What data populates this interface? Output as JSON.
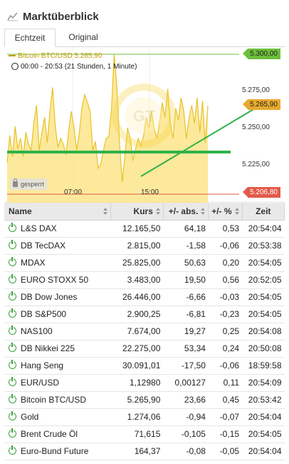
{
  "header": {
    "title": "Marktüberblick",
    "icon": "chart-line-icon"
  },
  "tabs": [
    {
      "label": "Echtzeit",
      "active": true
    },
    {
      "label": "Original",
      "active": false
    }
  ],
  "chart": {
    "series_label": "Bitcoin BTC/USD  5.265,90",
    "time_label": "00:00 - 20:53   (21 Stunden, 1 Minute)",
    "price_tags": {
      "high": "5.300,00",
      "current": "5.265,90",
      "low": "5.206,80"
    },
    "y_axis": [
      "5.275,00",
      "5.250,00",
      "5.225,00"
    ],
    "x_axis": [
      "07:00",
      "15:00"
    ],
    "locked_label": "gesperrt",
    "colors": {
      "fill": "#fbe27a",
      "line": "#e8c22a",
      "support": "#2fb34a",
      "high": "#6cbf3c",
      "current": "#e6a92e",
      "low": "#e35a4a"
    }
  },
  "chart_data": {
    "type": "area",
    "title": "Bitcoin BTC/USD",
    "x_range": [
      "00:00",
      "20:53"
    ],
    "ylim": [
      5206.8,
      5300.0
    ],
    "y_ticks": [
      5275.0,
      5250.0,
      5225.0
    ],
    "x_ticks": [
      "07:00",
      "15:00"
    ],
    "series": [
      {
        "name": "Bitcoin BTC/USD",
        "values": [
          5228,
          5246,
          5232,
          5252,
          5237,
          5244,
          5232,
          5248,
          5240,
          5236,
          5255,
          5266,
          5236,
          5248,
          5258,
          5241,
          5262,
          5278,
          5252,
          5238,
          5244,
          5240,
          5233,
          5249,
          5262,
          5251,
          5236,
          5248,
          5265,
          5273,
          5268,
          5262,
          5236,
          5242,
          5224,
          5227,
          5236,
          5244,
          5245,
          5263,
          5300,
          5278,
          5241,
          5215,
          5232,
          5251,
          5244,
          5229,
          5237,
          5244,
          5239,
          5246,
          5258,
          5251,
          5262,
          5250,
          5244,
          5255,
          5268,
          5258,
          5277,
          5254,
          5244,
          5264,
          5256,
          5271,
          5262,
          5244,
          5258,
          5266,
          5254,
          5271,
          5248,
          5269,
          5241,
          5265.9
        ]
      }
    ],
    "levels": {
      "high": 5300.0,
      "current": 5265.9,
      "low": 5206.8
    }
  },
  "table": {
    "headers": {
      "name": "Name",
      "kurs": "Kurs",
      "abs": "+/- abs.",
      "pct": "+/- %",
      "zeit": "Zeit"
    },
    "rows": [
      {
        "name": "L&S DAX",
        "kurs": "12.165,50",
        "abs": "64,18",
        "pct": "0,53",
        "zeit": "20:54:04",
        "dir": "pos"
      },
      {
        "name": "DB TecDAX",
        "kurs": "2.815,00",
        "abs": "-1,58",
        "pct": "-0,06",
        "zeit": "20:53:38",
        "dir": "neg"
      },
      {
        "name": "MDAX",
        "kurs": "25.825,00",
        "abs": "50,63",
        "pct": "0,20",
        "zeit": "20:54:05",
        "dir": "pos"
      },
      {
        "name": "EURO STOXX 50",
        "kurs": "3.483,00",
        "abs": "19,50",
        "pct": "0,56",
        "zeit": "20:52:05",
        "dir": "pos"
      },
      {
        "name": "DB Dow Jones",
        "kurs": "26.446,00",
        "abs": "-6,66",
        "pct": "-0,03",
        "zeit": "20:54:05",
        "dir": "neg"
      },
      {
        "name": "DB S&P500",
        "kurs": "2.900,25",
        "abs": "-6,81",
        "pct": "-0,23",
        "zeit": "20:54:05",
        "dir": "neg"
      },
      {
        "name": "NAS100",
        "kurs": "7.674,00",
        "abs": "19,27",
        "pct": "0,25",
        "zeit": "20:54:08",
        "dir": "pos"
      },
      {
        "name": "DB Nikkei 225",
        "kurs": "22.275,00",
        "abs": "53,34",
        "pct": "0,24",
        "zeit": "20:50:08",
        "dir": "pos"
      },
      {
        "name": "Hang Seng",
        "kurs": "30.091,01",
        "abs": "-17,50",
        "pct": "-0,06",
        "zeit": "18:59:58",
        "dir": "neg"
      },
      {
        "name": "EUR/USD",
        "kurs": "1,12980",
        "abs": "0,00127",
        "pct": "0,11",
        "zeit": "20:54:09",
        "dir": "pos"
      },
      {
        "name": "Bitcoin BTC/USD",
        "kurs": "5.265,90",
        "abs": "23,66",
        "pct": "0,45",
        "zeit": "20:53:42",
        "dir": "pos"
      },
      {
        "name": "Gold",
        "kurs": "1.274,06",
        "abs": "-0,94",
        "pct": "-0,07",
        "zeit": "20:54:04",
        "dir": "neg"
      },
      {
        "name": "Brent Crude Öl",
        "kurs": "71,615",
        "abs": "-0,105",
        "pct": "-0,15",
        "zeit": "20:54:05",
        "dir": "neg"
      },
      {
        "name": "Euro-Bund Future",
        "kurs": "164,37",
        "abs": "-0,08",
        "pct": "-0,05",
        "zeit": "20:54:04",
        "dir": "neg"
      }
    ]
  }
}
